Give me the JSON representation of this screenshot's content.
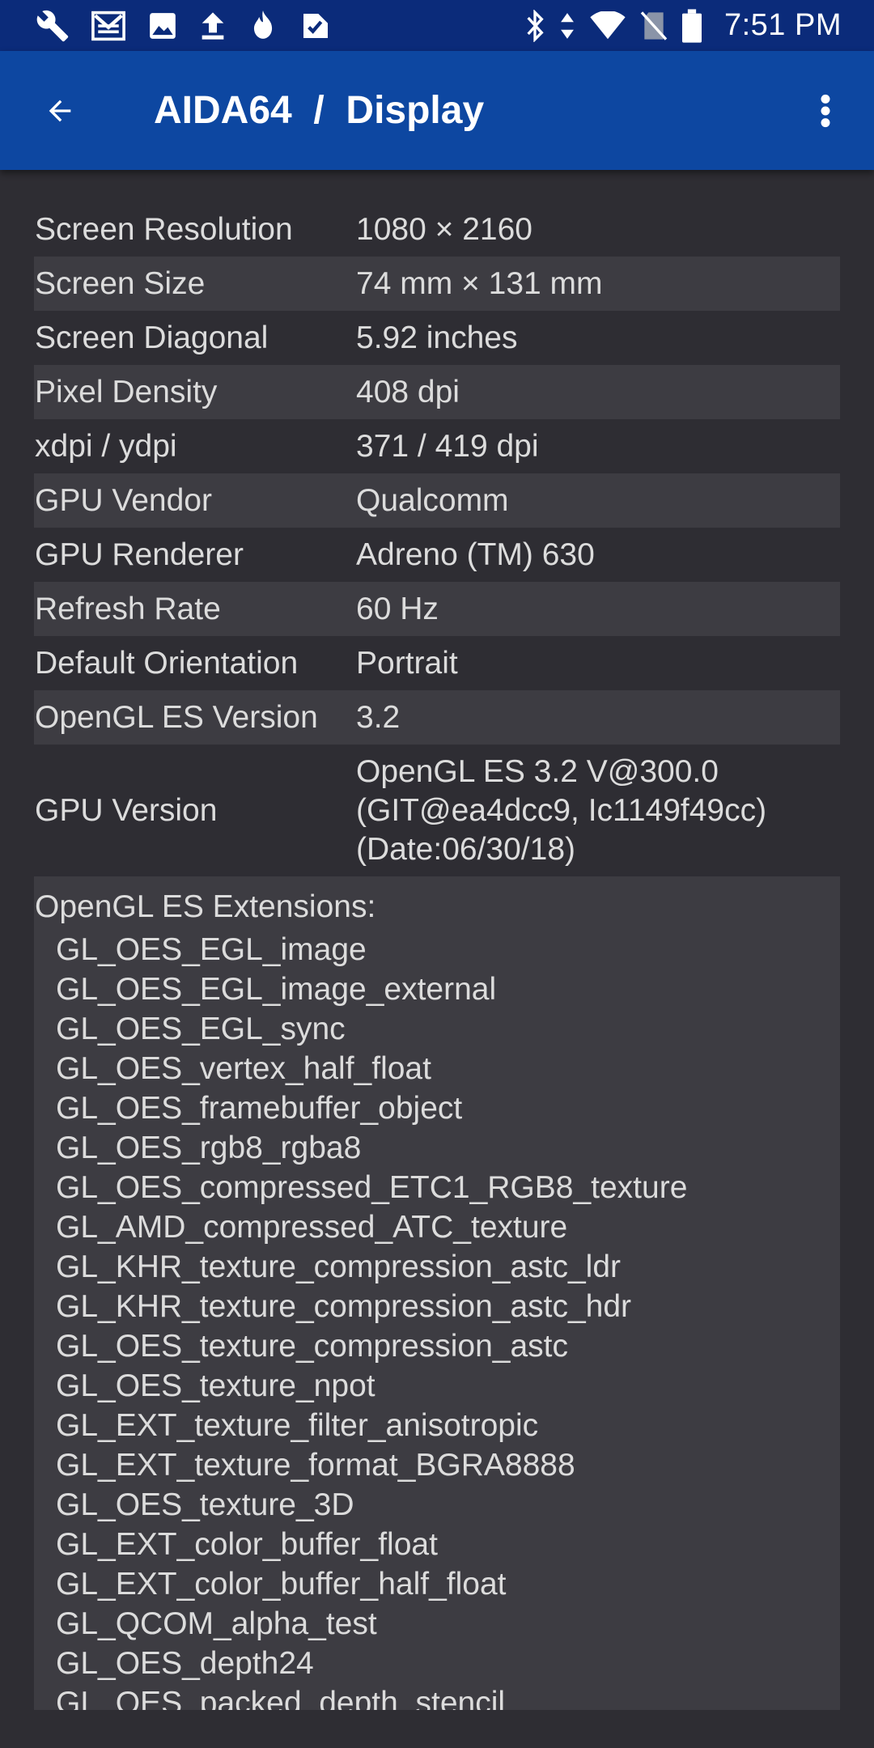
{
  "status_bar": {
    "time": "7:51 PM",
    "left_icons": [
      "wrench-icon",
      "gmail-icon",
      "image-icon",
      "upload-icon",
      "flame-icon",
      "check-document-icon"
    ],
    "right_icons": [
      "bluetooth-icon",
      "data-arrows-icon",
      "wifi-icon",
      "no-sim-icon",
      "battery-icon"
    ]
  },
  "app_bar": {
    "title": "AIDA64  /  Display"
  },
  "properties": [
    {
      "label": "Screen Resolution",
      "value": "1080 × 2160"
    },
    {
      "label": "Screen Size",
      "value": "74 mm × 131 mm"
    },
    {
      "label": "Screen Diagonal",
      "value": "5.92 inches"
    },
    {
      "label": "Pixel Density",
      "value": "408 dpi"
    },
    {
      "label": "xdpi / ydpi",
      "value": "371 / 419 dpi"
    },
    {
      "label": "GPU Vendor",
      "value": "Qualcomm"
    },
    {
      "label": "GPU Renderer",
      "value": "Adreno (TM) 630"
    },
    {
      "label": "Refresh Rate",
      "value": "60 Hz"
    },
    {
      "label": "Default Orientation",
      "value": "Portrait"
    },
    {
      "label": "OpenGL ES Version",
      "value": "3.2"
    },
    {
      "label": "GPU Version",
      "value": "OpenGL ES 3.2 V@300.0 (GIT@ea4dcc9, Ic1149f49cc) (Date:06/30/18)"
    }
  ],
  "extensions": {
    "title": "OpenGL ES Extensions:",
    "items": [
      "GL_OES_EGL_image",
      "GL_OES_EGL_image_external",
      "GL_OES_EGL_sync",
      "GL_OES_vertex_half_float",
      "GL_OES_framebuffer_object",
      "GL_OES_rgb8_rgba8",
      "GL_OES_compressed_ETC1_RGB8_texture",
      "GL_AMD_compressed_ATC_texture",
      "GL_KHR_texture_compression_astc_ldr",
      "GL_KHR_texture_compression_astc_hdr",
      "GL_OES_texture_compression_astc",
      "GL_OES_texture_npot",
      "GL_EXT_texture_filter_anisotropic",
      "GL_EXT_texture_format_BGRA8888",
      "GL_OES_texture_3D",
      "GL_EXT_color_buffer_float",
      "GL_EXT_color_buffer_half_float",
      "GL_QCOM_alpha_test",
      "GL_OES_depth24",
      "GL_OES_packed_depth_stencil"
    ]
  },
  "colors": {
    "status_bar": "#0b2b7a",
    "app_bar": "#0d47a1",
    "background": "#2e2d33",
    "row_alt": "#3d3c42",
    "text": "#dcdcdc"
  }
}
